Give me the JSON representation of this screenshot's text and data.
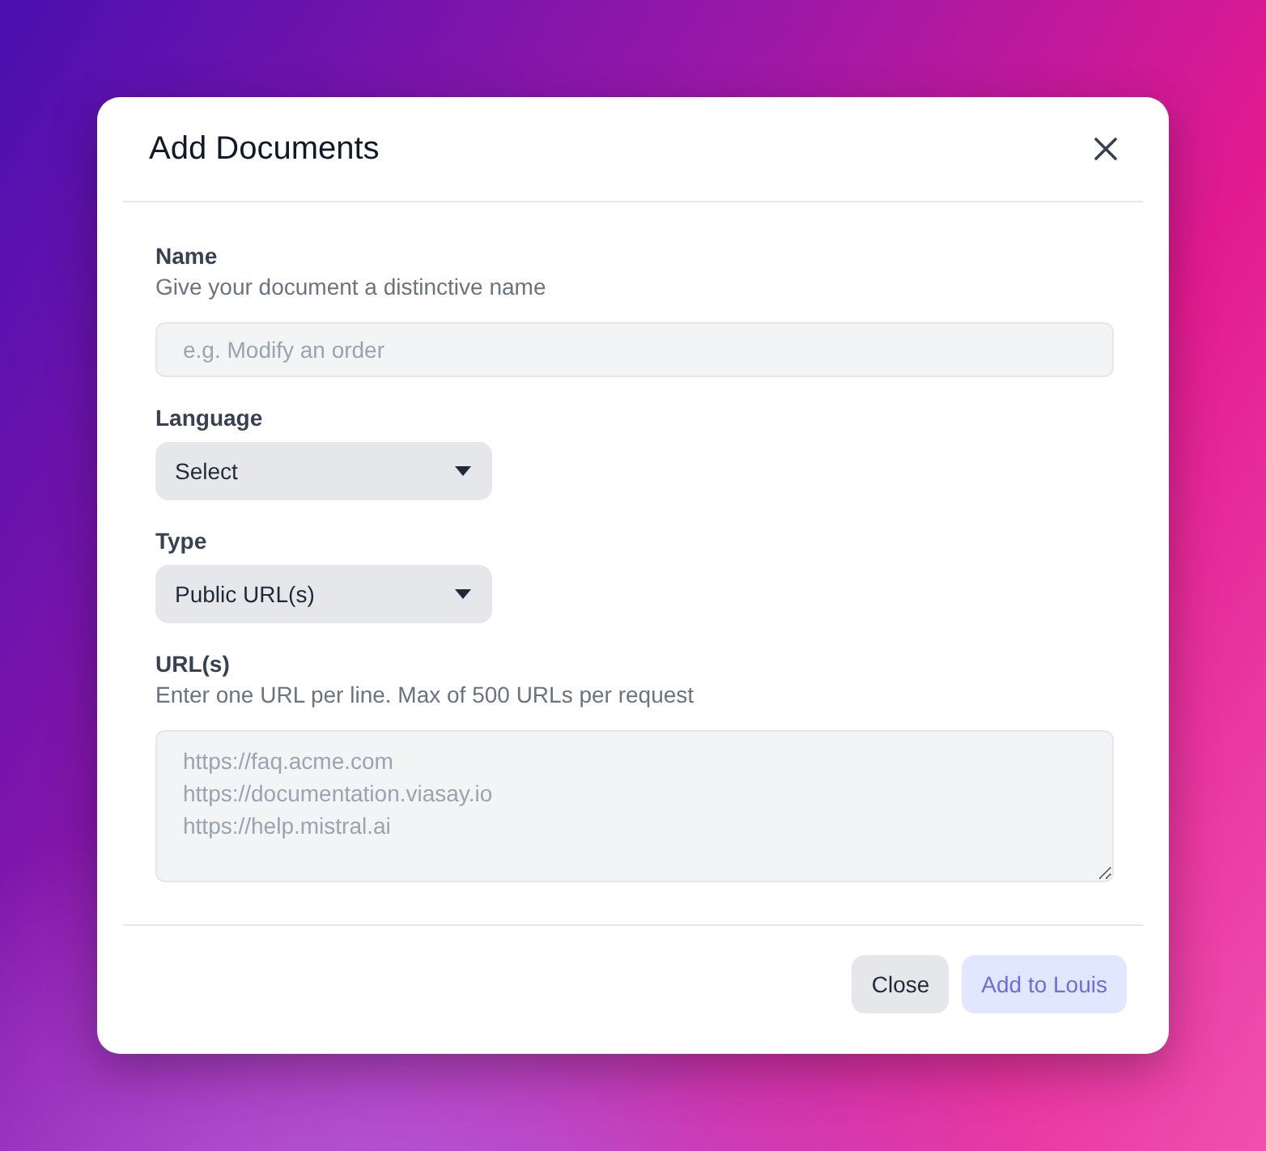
{
  "dialog": {
    "title": "Add Documents",
    "fields": [
      {
        "kind": "text",
        "label": "Name",
        "hint": "Give your document a distinctive name",
        "placeholder": "e.g. Modify an order"
      },
      {
        "kind": "select",
        "label": "Language",
        "value": "Select"
      },
      {
        "kind": "select",
        "label": "Type",
        "value": "Public URL(s)"
      },
      {
        "kind": "textarea",
        "label": "URL(s)",
        "hint": "Enter one URL per line. Max of 500 URLs per request",
        "placeholder": "https://faq.acme.com\nhttps://documentation.viasay.io\nhttps://help.mistral.ai"
      }
    ],
    "buttons": [
      {
        "label": "Close",
        "kind": "secondary",
        "disabled": false
      },
      {
        "label": "Add to Louis",
        "kind": "primary",
        "disabled": true
      }
    ]
  }
}
